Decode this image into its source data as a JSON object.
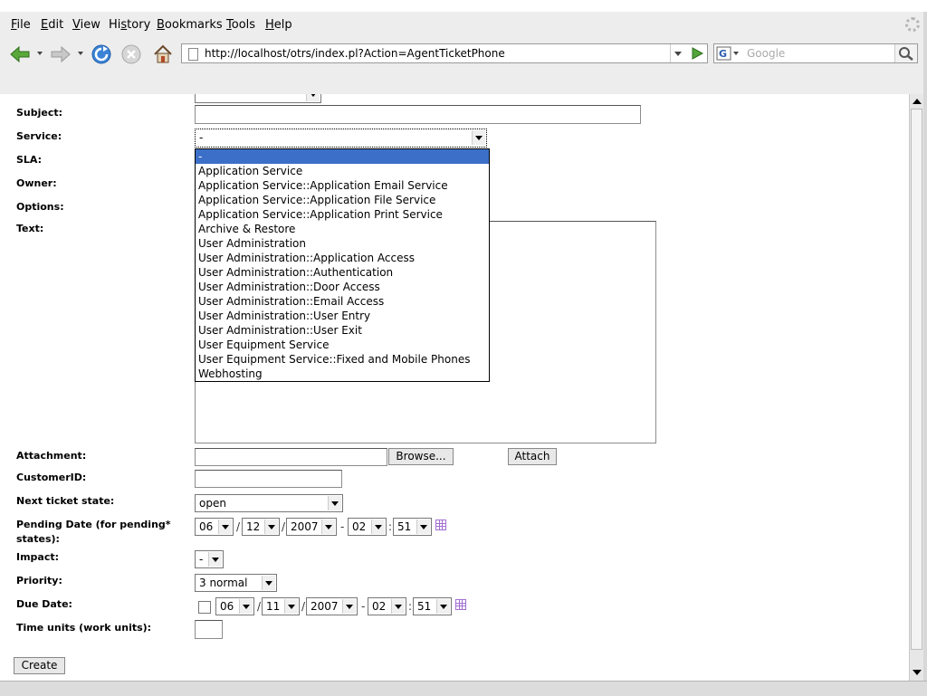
{
  "menubar": {
    "items": [
      {
        "pre": "",
        "ul": "F",
        "post": "ile"
      },
      {
        "pre": "",
        "ul": "E",
        "post": "dit"
      },
      {
        "pre": "",
        "ul": "V",
        "post": "iew"
      },
      {
        "pre": "Hi",
        "ul": "s",
        "post": "tory"
      },
      {
        "pre": "",
        "ul": "B",
        "post": "ookmarks"
      },
      {
        "pre": "",
        "ul": "T",
        "post": "ools"
      },
      {
        "pre": "",
        "ul": "H",
        "post": "elp"
      }
    ]
  },
  "navbar": {
    "url": "http://localhost/otrs/index.pl?Action=AgentTicketPhone",
    "search_placeholder": "Google",
    "search_engine_letter": "G"
  },
  "form": {
    "subject_label": "Subject:",
    "service_label": "Service:",
    "service_value": "-",
    "sla_label": "SLA:",
    "owner_label": "Owner:",
    "options_label": "Options:",
    "text_label": "Text:",
    "attachment_label": "Attachment:",
    "browse_button": "Browse...",
    "attach_button": "Attach",
    "customerid_label": "CustomerID:",
    "next_state_label": "Next ticket state:",
    "next_state_value": "open",
    "pending_label_line1": "Pending Date (for pending*",
    "pending_label_line2": "states):",
    "pending": {
      "month": "06",
      "day": "12",
      "year": "2007",
      "hour": "02",
      "minute": "51"
    },
    "impact_label": "Impact:",
    "impact_value": "-",
    "priority_label": "Priority:",
    "priority_value": "3 normal",
    "due_label": "Due Date:",
    "due": {
      "month": "06",
      "day": "11",
      "year": "2007",
      "hour": "02",
      "minute": "51"
    },
    "time_units_label": "Time units (work units):",
    "create_button": "Create",
    "sep_slash": "/",
    "sep_dash": "-",
    "sep_colon": ":"
  },
  "service_options": [
    "-",
    "Application Service",
    "Application Service::Application Email Service",
    "Application Service::Application File Service",
    "Application Service::Application Print Service",
    "Archive & Restore",
    "User Administration",
    "User Administration::Application Access",
    "User Administration::Authentication",
    "User Administration::Door Access",
    "User Administration::Email Access",
    "User Administration::User Entry",
    "User Administration::User Exit",
    "User Equipment Service",
    "User Equipment Service::Fixed and Mobile Phones",
    "Webhosting"
  ],
  "colors": {
    "selected_option": "#3c6fc8",
    "calendar_icon": "#a26fd1"
  }
}
